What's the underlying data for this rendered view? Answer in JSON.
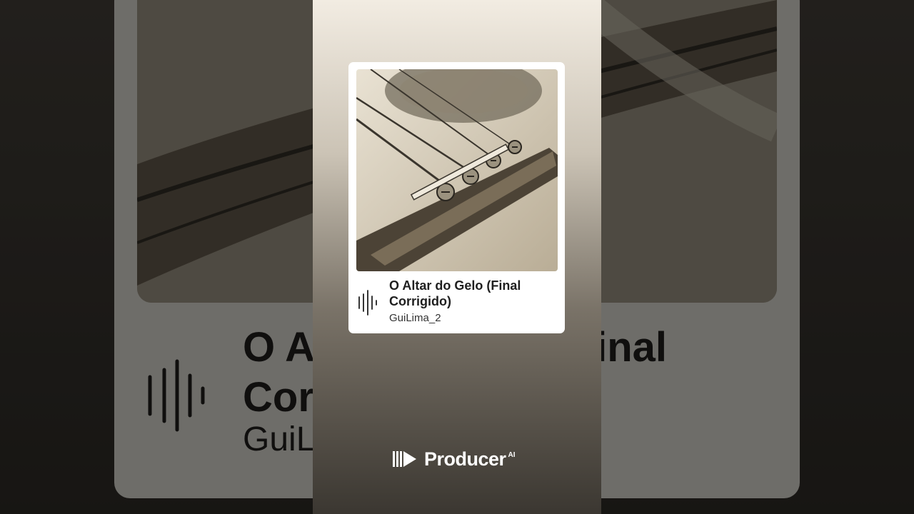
{
  "track": {
    "title": "O Altar do Gelo (Final Corrigido)",
    "artist": "GuiLima_2",
    "bg_title": "O Altar do Gelo (Final Corrigido)",
    "bg_artist": "GuiLima_2"
  },
  "icons": {
    "waveform": "audio-waveform-icon",
    "brand_logo": "producer-logo-icon"
  },
  "brand": {
    "name": "Producer",
    "suffix": "AI"
  },
  "colors": {
    "panel_top": "#f2ece2",
    "panel_bottom": "#3b3731",
    "card": "#ffffff",
    "text_dark": "#1f1f1f"
  }
}
